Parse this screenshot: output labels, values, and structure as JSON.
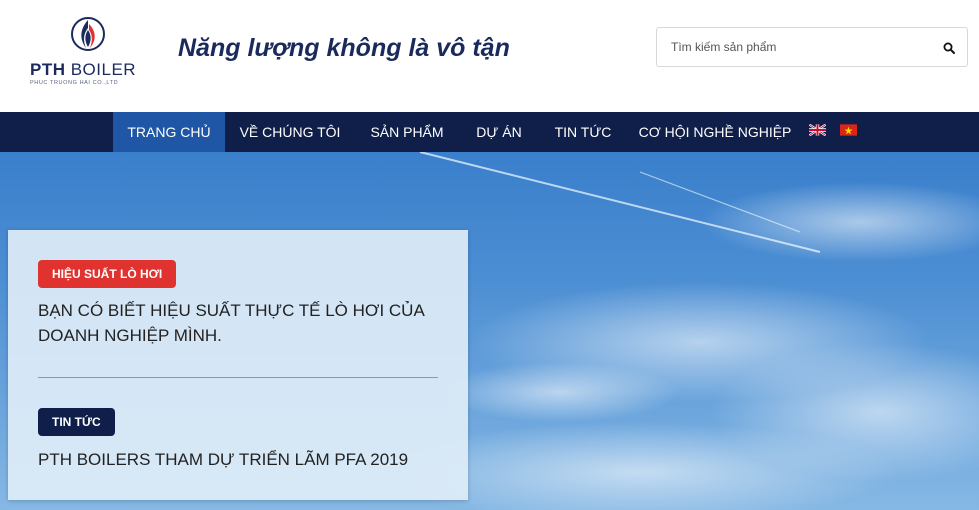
{
  "header": {
    "logo": {
      "name_bold": "PTH",
      "name_rest": " BOILER",
      "subtitle": "PHUC TRUONG HAI CO.,LTD"
    },
    "tagline": "Năng lượng không là vô tận",
    "search": {
      "placeholder": "Tìm kiếm sản phẩm",
      "value": "",
      "icon": "search-icon"
    }
  },
  "nav": {
    "items": [
      {
        "label": "TRANG CHỦ",
        "active": true
      },
      {
        "label": "VỀ CHÚNG TÔI",
        "active": false
      },
      {
        "label": "SẢN PHẨM",
        "active": false
      },
      {
        "label": "DỰ ÁN",
        "active": false
      },
      {
        "label": "TIN TỨC",
        "active": false
      },
      {
        "label": "CƠ HỘI NGHỀ NGHIỆP",
        "active": false
      }
    ],
    "languages": [
      {
        "icon": "uk-flag-icon"
      },
      {
        "icon": "vietnam-flag-icon"
      }
    ]
  },
  "hero": {
    "cards": [
      {
        "badge": "HIỆU SUẤT LÒ HƠI",
        "badge_color": "#e0332f",
        "title": "BẠN CÓ BIẾT HIỆU SUẤT THỰC TẾ LÒ HƠI CỦA DOANH NGHIỆP MÌNH."
      },
      {
        "badge": "TIN TỨC",
        "badge_color": "#0f1f4a",
        "title": "PTH BOILERS THAM DỰ TRIỂN LÃM PFA 2019"
      }
    ]
  },
  "colors": {
    "nav_bg": "#0f1f4a",
    "nav_active": "#1f57a6",
    "brand": "#1a2a5c",
    "accent_red": "#e0332f"
  }
}
